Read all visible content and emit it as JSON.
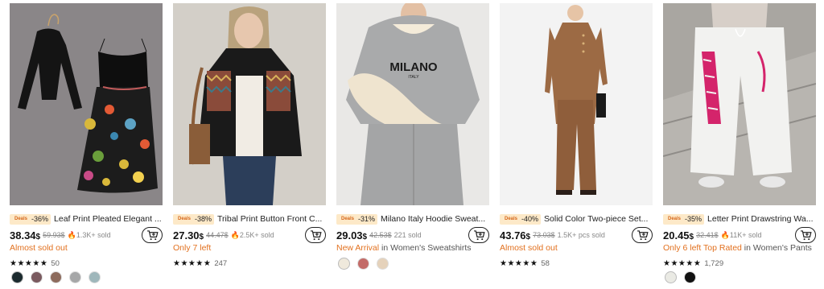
{
  "products": [
    {
      "badge": "Deals",
      "discount": "-36%",
      "title": "Leaf Print Pleated Elegant ...",
      "price": "38.34",
      "currency": "$",
      "old_price": "59.93$",
      "sold": "1.3K+ sold",
      "status": "Almost sold out",
      "rating_count": "50",
      "stars": "★★★★★",
      "swatch_colors": [
        "#1b2a2e",
        "#7a5a5f",
        "#8d6b5d",
        "#a6a7a8",
        "#9fb7bb"
      ]
    },
    {
      "badge": "Deals",
      "discount": "-38%",
      "title": "Tribal Print Button Front C...",
      "price": "27.30",
      "currency": "$",
      "old_price": "44.47$",
      "sold": "2.5K+ sold",
      "status": "Only 7 left",
      "rating_count": "247",
      "stars": "★★★★★",
      "swatch_colors": []
    },
    {
      "badge": "Deals",
      "discount": "-31%",
      "title": "Milano Italy Hoodie Sweat...",
      "price": "29.03",
      "currency": "$",
      "old_price": "42.53$",
      "sold": "221 sold",
      "status_highlight": "New Arrival",
      "status_rest": " in Women's Sweatshirts",
      "rating_count": "",
      "stars": "",
      "swatch_colors": [
        "#efe9dc",
        "#c36b68",
        "#e5d2bb"
      ],
      "hoodie_text": "MILANO",
      "hoodie_sub": "ITALY"
    },
    {
      "badge": "Deals",
      "discount": "-40%",
      "title": "Solid Color Two-piece Set...",
      "price": "43.76",
      "currency": "$",
      "old_price": "73.03$",
      "sold": "1.5K+ pcs sold",
      "status": "Almost sold out",
      "rating_count": "58",
      "stars": "★★★★★",
      "swatch_colors": []
    },
    {
      "badge": "Deals",
      "discount": "-35%",
      "title": "Letter Print Drawstring Wa...",
      "price": "20.45",
      "currency": "$",
      "old_price": "32.41$",
      "sold": "11K+ sold",
      "status_highlight": "Only 6 left",
      "status_mid": "  Top Rated",
      "status_rest": " in Women's Pants",
      "rating_count": "1,729",
      "stars": "★★★★★",
      "swatch_colors": [
        "#eaeae4",
        "#111111"
      ]
    }
  ],
  "colors": {
    "accent_orange": "#e2701e",
    "deal_bg": "#fde9c8"
  },
  "icons": {
    "cart": "add-to-cart-icon",
    "fire": "fire-icon",
    "star": "star-icon"
  }
}
